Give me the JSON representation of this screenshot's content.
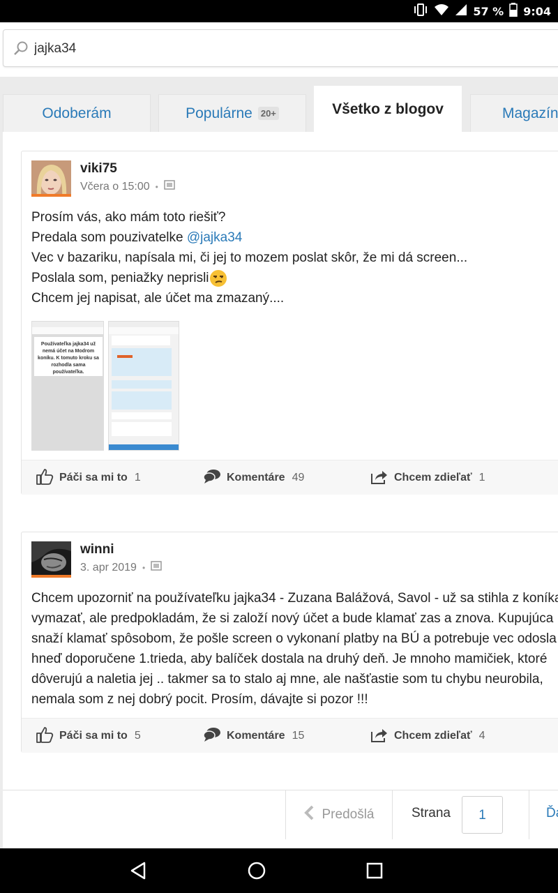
{
  "status_bar": {
    "battery": "57 %",
    "time": "9:04"
  },
  "search": {
    "value": "jajka34"
  },
  "tabs": [
    {
      "label": "Odoberám",
      "badge": ""
    },
    {
      "label": "Populárne",
      "badge": "20+"
    },
    {
      "label": "Všetko z blogov",
      "badge": ""
    },
    {
      "label": "Magazín",
      "badge": ""
    }
  ],
  "posts": [
    {
      "author": "viki75",
      "time": "Včera o 15:00",
      "lines": [
        "Prosím vás, ako mám toto riešiť?",
        "Predala som pouzivatelke ",
        "Vec v bazariku, napísala mi, či jej to mozem poslat skôr, že mi dá screen...",
        "Poslala som, peniažky neprisli",
        "Chcem jej napisat, ale účet ma zmazaný...."
      ],
      "mention": "@jajka34",
      "emoji": "😒",
      "screenshot_text": "Používateľka jajka34 už nemá účet na Modrom koníku. K tomuto kroku sa rozhodla sama používateľka.",
      "likes_label": "Páči sa mi to",
      "likes": "1",
      "comments_label": "Komentáre",
      "comments": "49",
      "share_label": "Chcem zdieľať",
      "shares": "1"
    },
    {
      "author": "winni",
      "time": "3. apr 2019",
      "lines": [
        "Chcem upozorniť na používateľku jajka34 - Zuzana Balážová, Savol - už sa stihla z koníka",
        "vymazať, ale predpokladám, že si založí nový účet a bude klamať zas a znova. Kupujúca",
        "snaží klamať spôsobom, že pošle screen o vykonaní platby na BÚ a potrebuje vec odosla",
        "hneď doporučene 1.trieda, aby balíček dostala na druhý deň. Je mnoho mamičiek, ktoré",
        "dôverujú a naletia jej .. takmer sa to stalo aj mne, ale našťastie som tu chybu neurobila,",
        "nemala som z nej dobrý pocit. Prosím, dávajte si pozor !!!"
      ],
      "likes_label": "Páči sa mi to",
      "likes": "5",
      "comments_label": "Komentáre",
      "comments": "15",
      "share_label": "Chcem zdieľať",
      "shares": "4"
    }
  ],
  "pagination": {
    "prev_label": "Predošlá",
    "page_label": "Strana",
    "page_value": "1",
    "next_label": "Ďa"
  }
}
